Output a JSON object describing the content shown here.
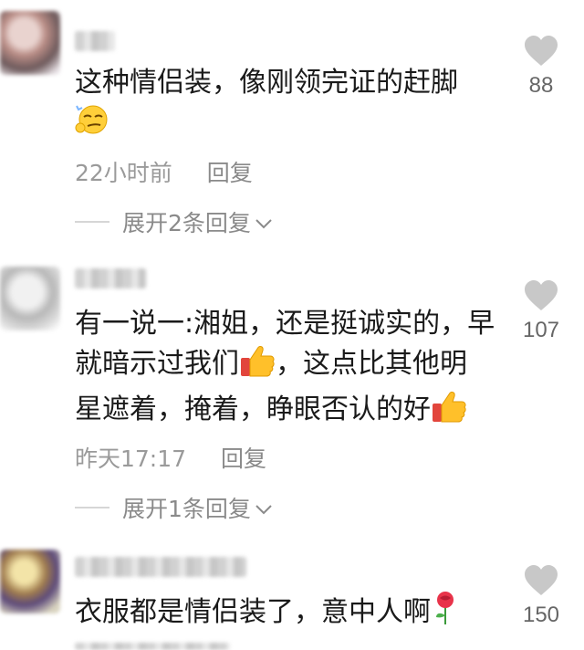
{
  "comments": [
    {
      "text_lines": [
        "这种情侣装，像刚领完证的赶脚"
      ],
      "time": "22小时前",
      "reply_label": "回复",
      "expand_label": "展开2条回复",
      "like_count": "88",
      "emoji": "smirk-emoji"
    },
    {
      "text_lines": [
        "有一说一:湘姐，还是挺诚实的，早",
        "就暗示过我们",
        "，这点比其他明",
        "星遮着，掩着，睁眼否认的好"
      ],
      "time": "昨天17:17",
      "reply_label": "回复",
      "expand_label": "展开1条回复",
      "like_count": "107",
      "emoji": "thumbs-up-emoji"
    },
    {
      "text_lines": [
        "衣服都是情侣装了，意中人啊"
      ],
      "like_count": "150",
      "emoji": "rose-emoji"
    }
  ],
  "colors": {
    "heart": "#c8c8c8",
    "meta": "#9a9a9a",
    "text": "#1a1a1a"
  }
}
